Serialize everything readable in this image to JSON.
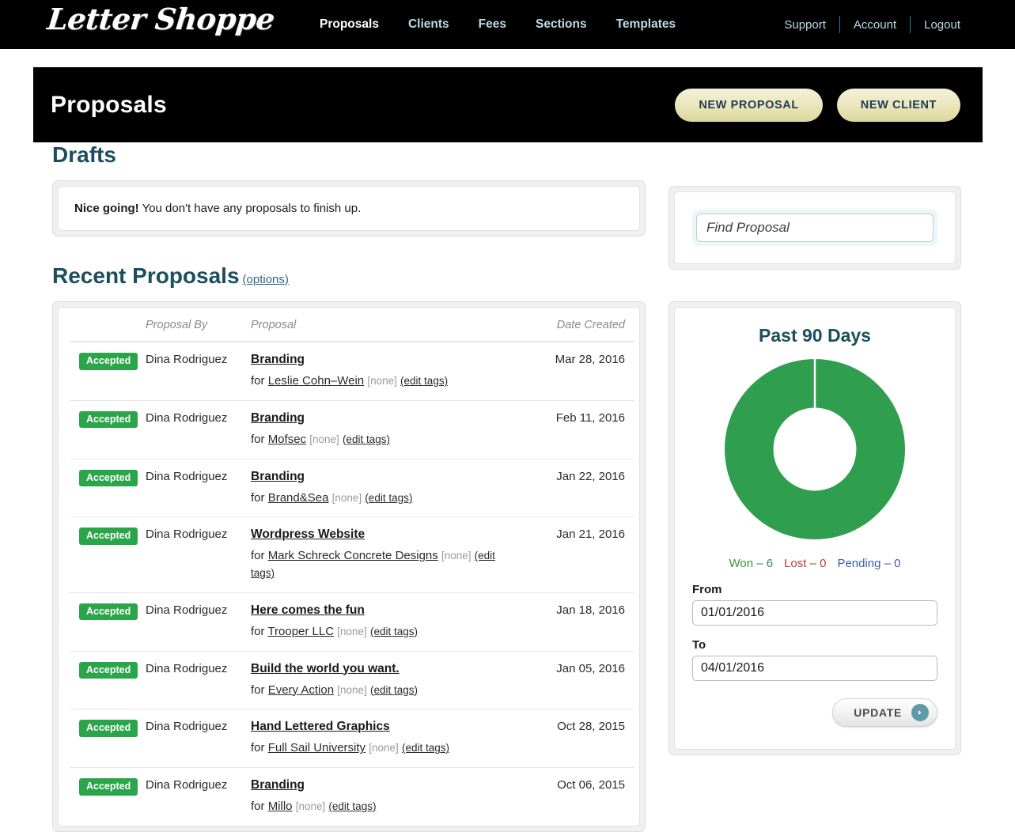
{
  "brand": {
    "logo_text": "Letter Shoppe"
  },
  "topnav": {
    "main": [
      {
        "label": "Proposals",
        "active": true
      },
      {
        "label": "Clients",
        "active": false
      },
      {
        "label": "Fees",
        "active": false
      },
      {
        "label": "Sections",
        "active": false
      },
      {
        "label": "Templates",
        "active": false
      }
    ],
    "util": [
      "Support",
      "Account",
      "Logout"
    ]
  },
  "page": {
    "title": "Proposals",
    "new_proposal_label": "NEW PROPOSAL",
    "new_client_label": "NEW CLIENT"
  },
  "drafts": {
    "heading": "Drafts",
    "notice_bold": "Nice going!",
    "notice_rest": " You don't have any proposals to finish up."
  },
  "recent": {
    "heading": "Recent Proposals",
    "options_label": "(options)",
    "columns": [
      "",
      "Proposal By",
      "Proposal",
      "Date Created"
    ],
    "rows": [
      {
        "status": "Accepted",
        "by": "Dina Rodriguez",
        "proposal": "Branding",
        "for_prefix": "for",
        "client": "Leslie Cohn–Wein",
        "tags": "[none]",
        "edit_tags": "(edit tags)",
        "date": "Mar 28, 2016"
      },
      {
        "status": "Accepted",
        "by": "Dina Rodriguez",
        "proposal": "Branding",
        "for_prefix": "for",
        "client": "Mofsec",
        "tags": "[none]",
        "edit_tags": "(edit tags)",
        "date": "Feb 11, 2016"
      },
      {
        "status": "Accepted",
        "by": "Dina Rodriguez",
        "proposal": "Branding",
        "for_prefix": "for",
        "client": "Brand&Sea",
        "tags": "[none]",
        "edit_tags": "(edit tags)",
        "date": "Jan 22, 2016"
      },
      {
        "status": "Accepted",
        "by": "Dina Rodriguez",
        "proposal": "Wordpress Website",
        "for_prefix": "for",
        "client": "Mark Schreck Concrete Designs",
        "tags": "[none]",
        "edit_tags": "(edit tags)",
        "date": "Jan 21, 2016"
      },
      {
        "status": "Accepted",
        "by": "Dina Rodriguez",
        "proposal": "Here comes the fun",
        "for_prefix": "for",
        "client": "Trooper LLC",
        "tags": "[none]",
        "edit_tags": "(edit tags)",
        "date": "Jan 18, 2016"
      },
      {
        "status": "Accepted",
        "by": "Dina Rodriguez",
        "proposal": "Build the world you want.",
        "for_prefix": "for",
        "client": "Every Action",
        "tags": "[none]",
        "edit_tags": "(edit tags)",
        "date": "Jan 05, 2016"
      },
      {
        "status": "Accepted",
        "by": "Dina Rodriguez",
        "proposal": "Hand Lettered Graphics",
        "for_prefix": "for",
        "client": "Full Sail University",
        "tags": "[none]",
        "edit_tags": "(edit tags)",
        "date": "Oct 28, 2015"
      },
      {
        "status": "Accepted",
        "by": "Dina Rodriguez",
        "proposal": "Branding",
        "for_prefix": "for",
        "client": "Millo",
        "tags": "[none]",
        "edit_tags": "(edit tags)",
        "date": "Oct 06, 2015"
      }
    ]
  },
  "search": {
    "placeholder": "Find Proposal",
    "value": ""
  },
  "stats": {
    "title": "Past 90 Days",
    "from_label": "From",
    "from_value": "01/01/2016",
    "to_label": "To",
    "to_value": "04/01/2016",
    "update_label": "UPDATE",
    "legend": {
      "won": "Won – 6",
      "lost": "Lost – 0",
      "pending": "Pending – 0"
    }
  },
  "chart_data": {
    "type": "pie",
    "title": "Past 90 Days",
    "variant": "donut",
    "categories": [
      "Won",
      "Lost",
      "Pending"
    ],
    "values": [
      6,
      0,
      0
    ],
    "colors": [
      "#2f9e4f",
      "#c0392b",
      "#3b5fa8"
    ],
    "total": 6,
    "legend_position": "bottom",
    "inner_radius_ratio": 0.46,
    "start_angle_deg": -90,
    "grid": false,
    "xlabel": "",
    "ylabel": ""
  },
  "colors": {
    "accent_green": "#2aa54a",
    "heading_teal": "#1b4f5e",
    "nav_link": "#bcdbe8",
    "button_cream": "#ebe6bc",
    "arrow_teal": "#5f9aa8"
  }
}
